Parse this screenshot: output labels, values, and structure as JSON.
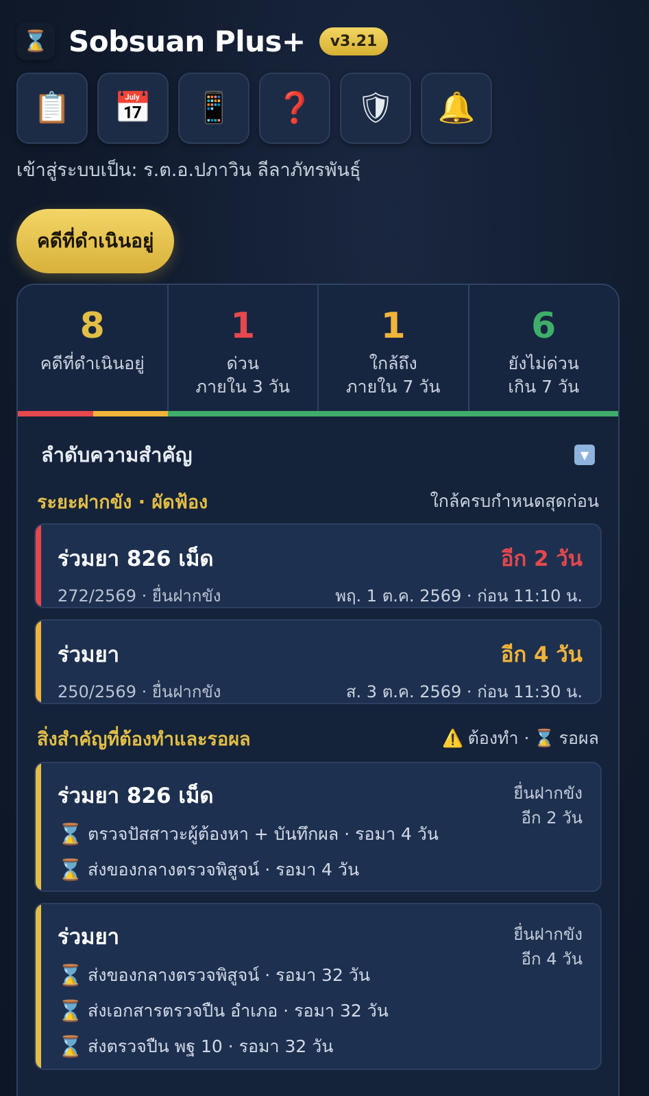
{
  "header": {
    "logo_glyph": "⌛",
    "title": "Sobsuan Plus+",
    "version": "v3.21"
  },
  "toolbar": [
    {
      "icon": "clipboard-icon",
      "glyph": "📋"
    },
    {
      "icon": "calendar-icon",
      "glyph": "📅"
    },
    {
      "icon": "phone-icon",
      "glyph": "📱"
    },
    {
      "icon": "help-icon",
      "glyph": "❓"
    },
    {
      "icon": "shield-icon",
      "glyph": "🛡"
    },
    {
      "icon": "bell-icon",
      "glyph": "🔔"
    }
  ],
  "login_text": "เข้าสู่ระบบเป็น: ร.ต.อ.ปภาวิน ลีลาภัทรพันธุ์",
  "active_pill": "คดีที่ดำเนินอยู่",
  "stats": [
    {
      "value": "8",
      "label1": "คดีที่ดำเนินอยู่",
      "label2": "",
      "color": "#e2be45"
    },
    {
      "value": "1",
      "label1": "ด่วน",
      "label2": "ภายใน 3 วัน",
      "color": "#e5484d"
    },
    {
      "value": "1",
      "label1": "ใกล้ถึง",
      "label2": "ภายใน 7 วัน",
      "color": "#f0b43a"
    },
    {
      "value": "6",
      "label1": "ยังไม่ด่วน",
      "label2": "เกิน 7 วัน",
      "color": "#3fae6a"
    }
  ],
  "bar_segments": [
    {
      "fraction": 0.125,
      "color": "#e5484d"
    },
    {
      "fraction": 0.125,
      "color": "#f0b43a"
    },
    {
      "fraction": 0.75,
      "color": "#3fae6a"
    }
  ],
  "priority": {
    "title": "ลำดับความสำคัญ",
    "dropdown_icon": "▼"
  },
  "detention": {
    "title": "ระยะฝากขัง · ผัดฟ้อง",
    "sort_note": "ใกล้ครบกำหนดสุดก่อน",
    "cards": [
      {
        "title": "ร่วมยา 826 เม็ด",
        "sub": "272/2569 · ยื่นฝากขัง",
        "due": "อีก 2 วัน",
        "deadline": "พฤ. 1 ต.ค. 2569 · ก่อน 11:10 น.",
        "color": "#e5484d"
      },
      {
        "title": "ร่วมยา",
        "sub": "250/2569 · ยื่นฝากขัง",
        "due": "อีก 4 วัน",
        "deadline": "ส. 3 ต.ค. 2569 · ก่อน 11:30 น.",
        "color": "#f0b43a"
      }
    ]
  },
  "todo": {
    "title": "สิ่งสำคัญที่ต้องทำและรอผล",
    "legend_todo_glyph": "⚠️",
    "legend_todo": "ต้องทำ ·",
    "legend_wait_glyph": "⌛",
    "legend_wait": "รอผล",
    "cards": [
      {
        "title": "ร่วมยา 826 เม็ด",
        "note1": "ยื่นฝากขัง",
        "note2": "อีก 2 วัน",
        "tasks": [
          "ตรวจปัสสาวะผู้ต้องหา + บันทึกผล · รอมา 4 วัน",
          "ส่งของกลางตรวจพิสูจน์ · รอมา 4 วัน"
        ]
      },
      {
        "title": "ร่วมยา",
        "note1": "ยื่นฝากขัง",
        "note2": "อีก 4 วัน",
        "tasks": [
          "ส่งของกลางตรวจพิสูจน์ · รอมา 32 วัน",
          "ส่งเอกสารตรวจปืน อำเภอ · รอมา 32 วัน",
          "ส่งตรวจปืน พฐ 10 · รอมา 32 วัน"
        ]
      }
    ]
  },
  "accent_color": "#e2be45"
}
